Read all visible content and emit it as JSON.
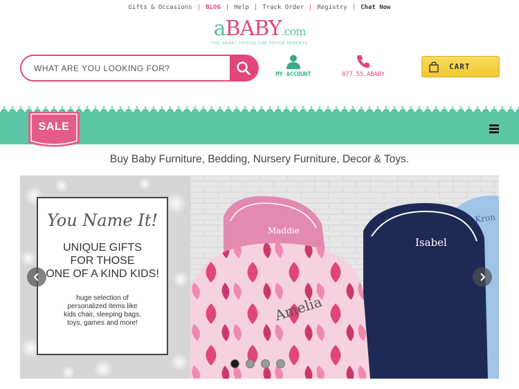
{
  "topnav": {
    "gifts": "Gifts & Occasions",
    "blog": "BLOG",
    "help": "Help",
    "track": "Track Order",
    "registry": "Registry",
    "chat": "Chat Now",
    "separator": "|"
  },
  "logo": {
    "a": "a",
    "baby": "BABY",
    "com": ".com",
    "tagline": "THE SMART CHOICE FOR PROUD PARENTS"
  },
  "search": {
    "placeholder": "WHAT ARE YOU LOOKING FOR?",
    "icon": "search-icon"
  },
  "account": {
    "label": "MY ACCOUNT",
    "icon": "user-icon"
  },
  "phone": {
    "label": "877.55.ABABY",
    "icon": "phone-icon"
  },
  "cart": {
    "label": "CART",
    "icon": "shopping-bag-icon"
  },
  "sale_badge": "SALE",
  "menu_icon": "hamburger-menu-icon",
  "headline": "Buy Baby Furniture, Bedding, Nursery Furniture, Decor & Toys.",
  "hero": {
    "script_title": "You Name It!",
    "big_lines": [
      "UNIQUE GIFTS",
      "FOR THOSE",
      "ONE OF A KIND KIDS!"
    ],
    "small_lines": [
      "huge selection of",
      "personalized items like",
      "kids chair, sleeping bags,",
      "toys, games and more!"
    ],
    "chair_names": [
      "Maddie",
      "Isabel",
      "Kron",
      "Amelia"
    ],
    "prev_icon": "chevron-left-icon",
    "next_icon": "chevron-right-icon",
    "slides": 4,
    "active_slide": 1
  },
  "colors": {
    "pink": "#e0467b",
    "teal": "#5cc5a7",
    "yellow": "#f4cf40"
  }
}
